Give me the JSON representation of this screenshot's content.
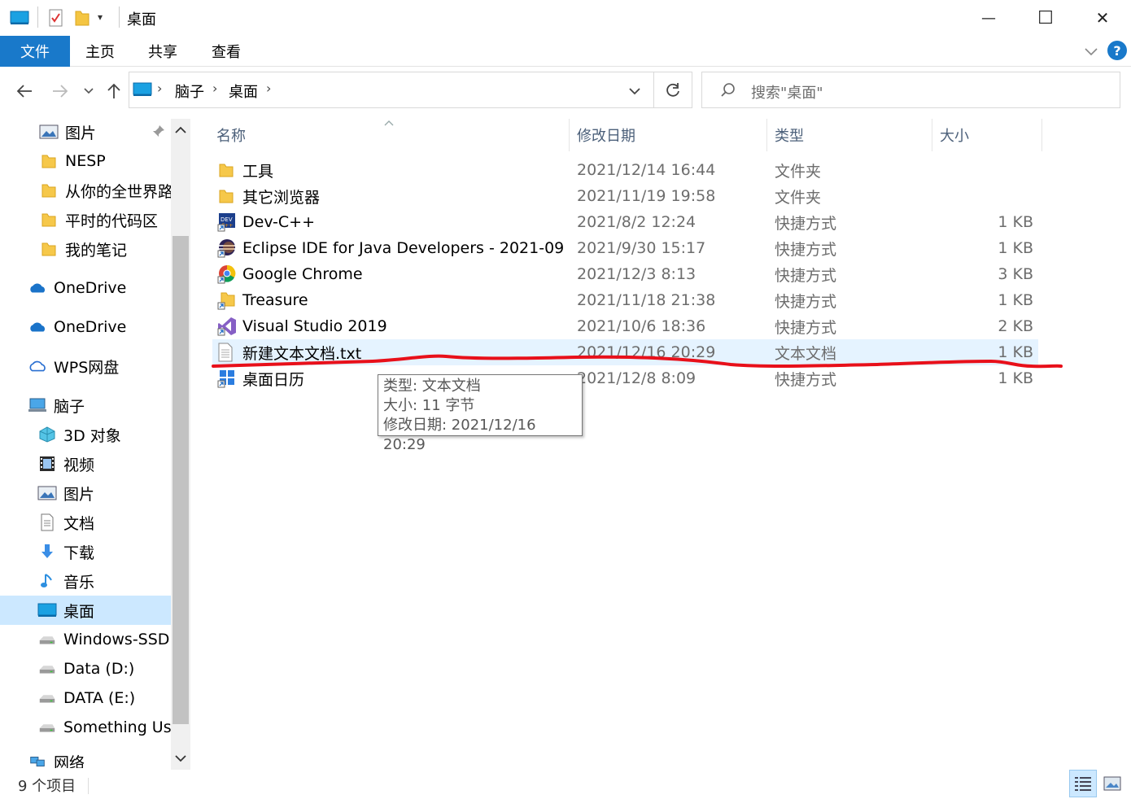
{
  "window": {
    "title": "桌面",
    "minimize_glyph": "—",
    "maximize_glyph": "☐",
    "close_glyph": "✕"
  },
  "ribbon": {
    "tabs": [
      "文件",
      "主页",
      "共享",
      "查看"
    ],
    "help_glyph": "?"
  },
  "address": {
    "segments": [
      "脑子",
      "桌面"
    ],
    "search_placeholder": "搜索\"桌面\""
  },
  "nav": {
    "items": [
      {
        "label": "图片",
        "icon": "pictures-icon"
      },
      {
        "label": "NESP",
        "icon": "folder-icon"
      },
      {
        "label": "从你的全世界路过",
        "icon": "folder-icon"
      },
      {
        "label": "平时的代码区",
        "icon": "folder-icon"
      },
      {
        "label": "我的笔记",
        "icon": "folder-icon"
      },
      {
        "label": "OneDrive",
        "icon": "onedrive-icon"
      },
      {
        "label": "OneDrive",
        "icon": "onedrive-icon"
      },
      {
        "label": "WPS网盘",
        "icon": "wps-cloud-icon"
      },
      {
        "label": "脑子",
        "icon": "computer-icon"
      },
      {
        "label": "3D 对象",
        "icon": "3d-objects-icon"
      },
      {
        "label": "视频",
        "icon": "videos-icon"
      },
      {
        "label": "图片",
        "icon": "pictures-icon"
      },
      {
        "label": "文档",
        "icon": "documents-icon"
      },
      {
        "label": "下载",
        "icon": "downloads-icon"
      },
      {
        "label": "音乐",
        "icon": "music-icon"
      },
      {
        "label": "桌面",
        "icon": "desktop-icon"
      },
      {
        "label": "Windows-SSD (C:)",
        "icon": "drive-icon"
      },
      {
        "label": "Data (D:)",
        "icon": "drive-icon"
      },
      {
        "label": "DATA (E:)",
        "icon": "drive-icon"
      },
      {
        "label": "Something Useful",
        "icon": "drive-icon"
      },
      {
        "label": "网络",
        "icon": "network-icon"
      }
    ]
  },
  "columns": {
    "name": "名称",
    "date": "修改日期",
    "type": "类型",
    "size": "大小"
  },
  "files": [
    {
      "name": "工具",
      "date": "2021/12/14 16:44",
      "type": "文件夹",
      "size": "",
      "icon": "folder-icon"
    },
    {
      "name": "其它浏览器",
      "date": "2021/11/19 19:58",
      "type": "文件夹",
      "size": "",
      "icon": "folder-icon"
    },
    {
      "name": "Dev-C++",
      "date": "2021/8/2 12:24",
      "type": "快捷方式",
      "size": "1 KB",
      "icon": "devcpp-icon"
    },
    {
      "name": "Eclipse IDE for Java Developers - 2021-09",
      "date": "2021/9/30 15:17",
      "type": "快捷方式",
      "size": "1 KB",
      "icon": "eclipse-icon"
    },
    {
      "name": "Google Chrome",
      "date": "2021/12/3 8:13",
      "type": "快捷方式",
      "size": "3 KB",
      "icon": "chrome-icon"
    },
    {
      "name": "Treasure",
      "date": "2021/11/18 21:38",
      "type": "快捷方式",
      "size": "1 KB",
      "icon": "folder-shortcut-icon"
    },
    {
      "name": "Visual Studio 2019",
      "date": "2021/10/6 18:36",
      "type": "快捷方式",
      "size": "2 KB",
      "icon": "visual-studio-icon"
    },
    {
      "name": "新建文本文档.txt",
      "date": "2021/12/16 20:29",
      "type": "文本文档",
      "size": "1 KB",
      "icon": "text-file-icon"
    },
    {
      "name": "桌面日历",
      "date": "2021/12/8 8:09",
      "type": "快捷方式",
      "size": "1 KB",
      "icon": "calendar-icon"
    }
  ],
  "tooltip": {
    "line1": "类型: 文本文档",
    "line2": "大小: 11 字节",
    "line3": "修改日期: 2021/12/16 20:29"
  },
  "status": {
    "count": "9 个项目"
  },
  "colors": {
    "accent": "#1979ca",
    "selected_row": "#e5f3ff",
    "nav_selected": "#cce8ff",
    "annotation": "#e8101a"
  }
}
